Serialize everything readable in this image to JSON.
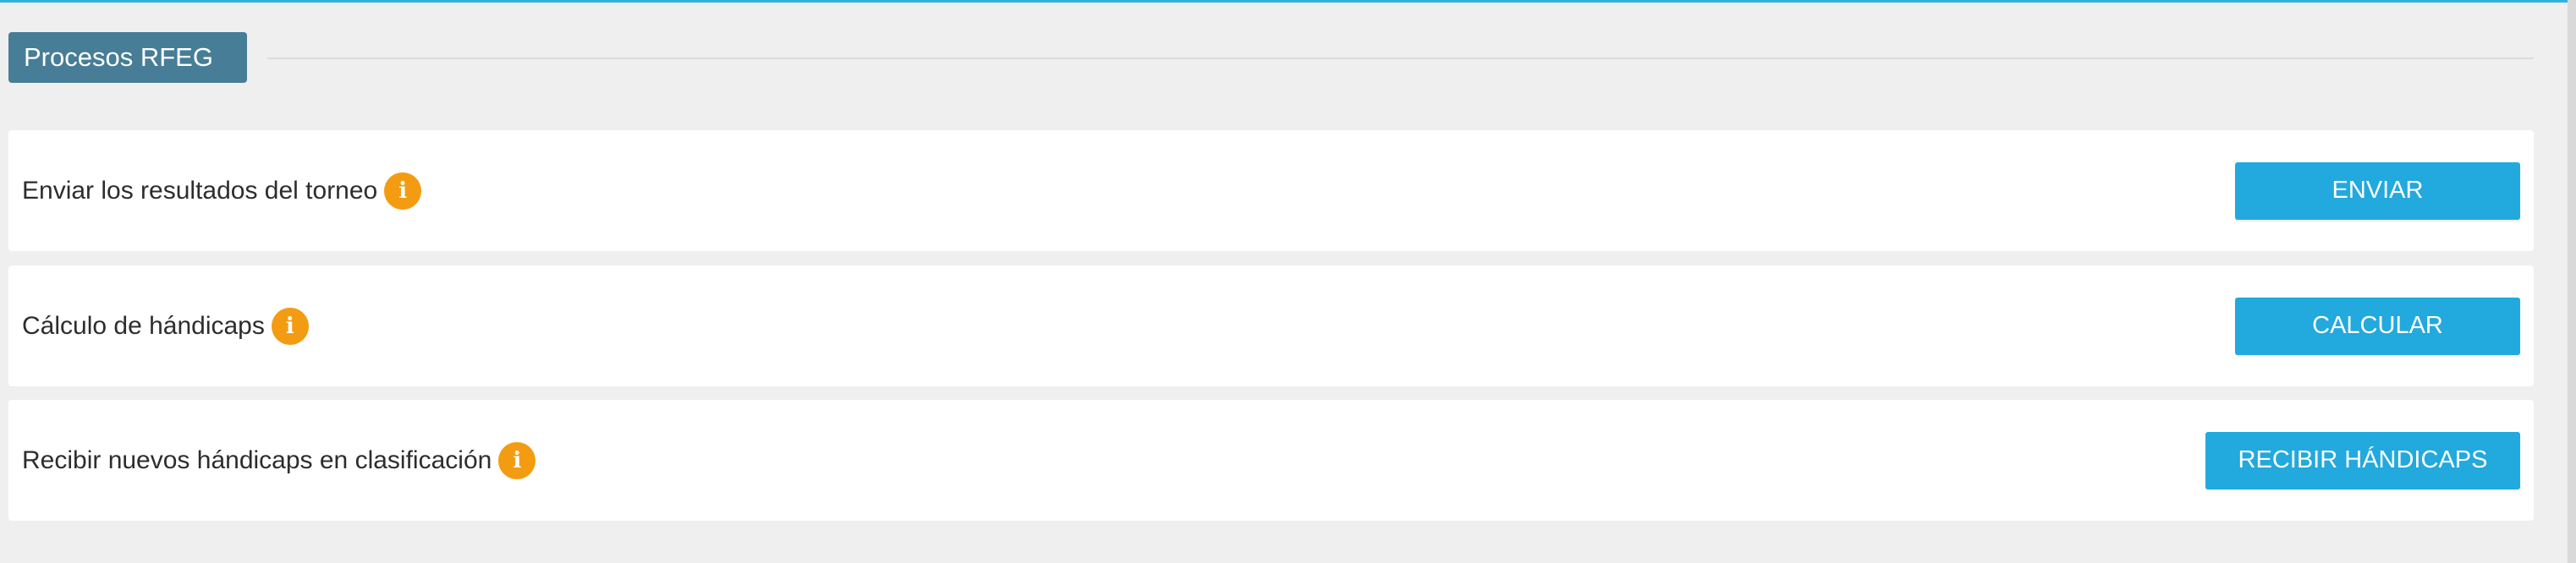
{
  "section": {
    "title": "Procesos RFEG"
  },
  "rows": [
    {
      "label": "Enviar los resultados del torneo",
      "button": "ENVIAR"
    },
    {
      "label": "Cálculo de hándicaps",
      "button": "CALCULAR"
    },
    {
      "label": "Recibir nuevos hándicaps en clasificación",
      "button": "RECIBIR HÁNDICAPS"
    }
  ],
  "icons": {
    "info": "info-icon",
    "info_glyph": "i"
  },
  "colors": {
    "accent": "#22a9de",
    "section_header": "#477d96",
    "info": "#f39c12",
    "background": "#efefef",
    "top_border": "#2cb3e0"
  }
}
